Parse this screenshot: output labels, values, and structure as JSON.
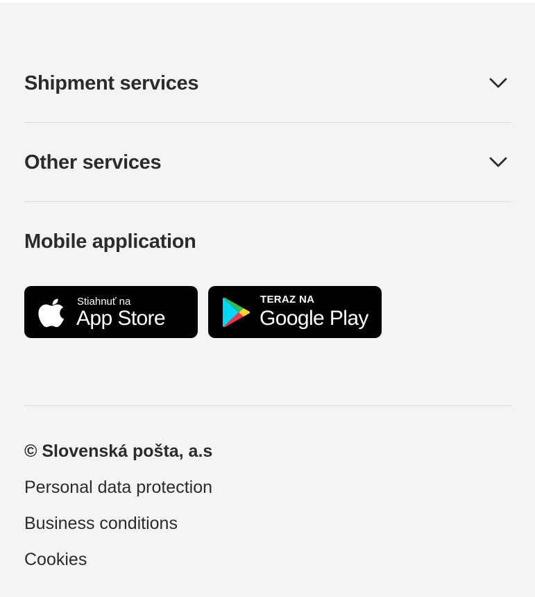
{
  "accordion": [
    {
      "label": "Shipment services"
    },
    {
      "label": "Other services"
    }
  ],
  "mobile": {
    "title": "Mobile application",
    "app_store": {
      "small": "Stiahnuť na",
      "big": "App Store"
    },
    "google_play": {
      "small": "TERAZ NA",
      "big": "Google Play"
    }
  },
  "legal": {
    "copyright": "© Slovenská pošta, a.s",
    "links": [
      "Personal data protection",
      "Business conditions",
      "Cookies"
    ]
  },
  "colors": {
    "background": "#f4f4f4",
    "text": "#2b2b2b",
    "divider": "#d9d9d9",
    "badge": "#000000"
  }
}
